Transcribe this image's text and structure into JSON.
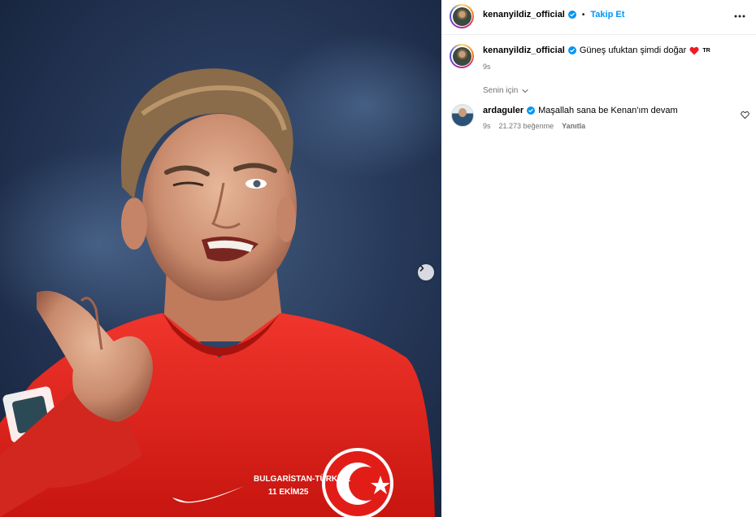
{
  "post": {
    "author": "kenanyildiz_official",
    "header_separator": "•",
    "follow_label": "Takip Et",
    "caption": {
      "username": "kenanyildiz_official",
      "text": "Güneş ufuktan şimdi doğar",
      "flag": "TR",
      "time": "9s"
    },
    "sort_label": "Senin için"
  },
  "photo": {
    "jersey_text_1": "BULGARİSTAN-TÜRKİYE",
    "jersey_text_2": "11 EKİM25"
  },
  "comments": [
    {
      "username": "ardaguler",
      "text": "Maşallah sana be Kenan'ım devam",
      "time": "9s",
      "likes": "21.273 beğenme",
      "reply_label": "Yanıtla"
    }
  ],
  "colors": {
    "follow": "#0095f6",
    "verified": "#0095f6",
    "muted": "#737373",
    "heart": "#ed1c24",
    "jersey": "#e3201c"
  },
  "icons": {
    "verified": "verified-badge-icon",
    "more": "more-options-icon",
    "chevron": "chevron-down-icon",
    "like": "heart-outline-icon",
    "next": "chevron-right-icon"
  }
}
